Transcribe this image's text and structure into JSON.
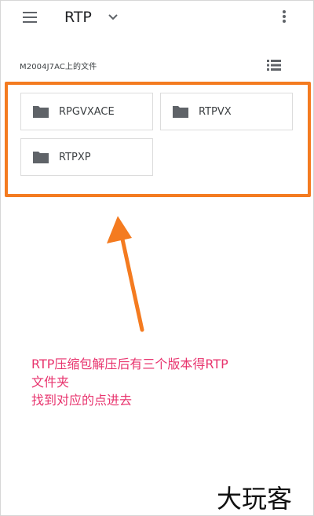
{
  "appbar": {
    "title": "RTP",
    "menu_icon": "hamburger-menu-icon",
    "dropdown_icon": "chevron-down-icon",
    "more_icon": "more-vert-icon"
  },
  "subheader": {
    "label": "M2004J7AC上的文件",
    "view_icon": "list-view-icon"
  },
  "folders": [
    {
      "name": "RPGVXACE",
      "icon": "folder-icon"
    },
    {
      "name": "RTPVX",
      "icon": "folder-icon"
    },
    {
      "name": "RTPXP",
      "icon": "folder-icon"
    }
  ],
  "annotation": {
    "line1": "RTP压缩包解压后有三个版本得RTP",
    "line2": "文件夹",
    "line3": "找到对应的点进去",
    "highlight_color": "#f47b20",
    "text_color": "#e8346e"
  },
  "watermark": "大玩客"
}
